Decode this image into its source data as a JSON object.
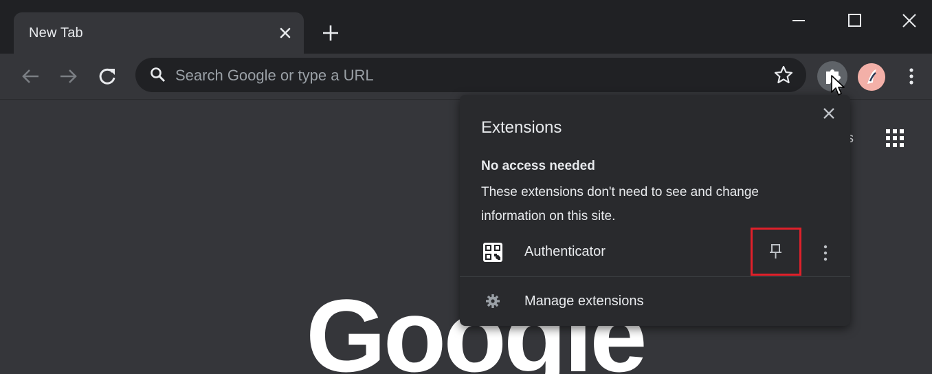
{
  "tab": {
    "title": "New Tab"
  },
  "omnibox": {
    "placeholder": "Search Google or type a URL"
  },
  "page": {
    "partial_link": "s",
    "logo_text": "Google"
  },
  "extensions_popup": {
    "title": "Extensions",
    "section_heading": "No access needed",
    "section_description": "These extensions don't need to see and change information on this site.",
    "extension_name": "Authenticator",
    "manage_label": "Manage extensions"
  },
  "colors": {
    "pin_highlight": "#e0202a",
    "background": "#35363a",
    "popup_background": "#292a2d"
  }
}
